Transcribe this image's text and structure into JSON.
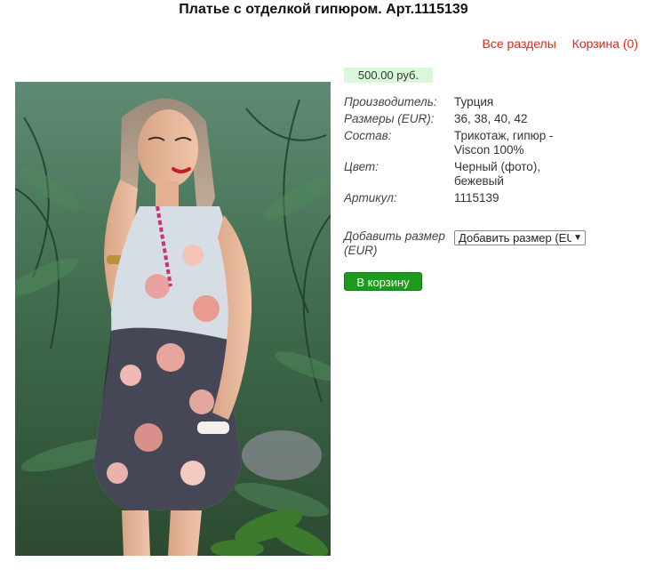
{
  "product": {
    "title": "Платье с отделкой гипюром. Арт.1115139",
    "price": "500.00 руб.",
    "props": [
      {
        "k": "Производитель:",
        "v": "Турция"
      },
      {
        "k": "Размеры (EUR):",
        "v": "36, 38, 40, 42"
      },
      {
        "k": "Состав:",
        "v": "Трикотаж, гипюр - Viscon 100%"
      },
      {
        "k": "Цвет:",
        "v": "Черный (фото), бежевый"
      },
      {
        "k": "Артикул:",
        "v": "1115139"
      }
    ],
    "add_size_label": "Добавить размер (EUR)",
    "size_select_value": "Добавить размер (EU",
    "cart_button": "В корзину"
  },
  "links": {
    "all_sections": "Все разделы",
    "cart": "Корзина (0)"
  },
  "colors": {
    "link": "#e0261b",
    "price_bg": "#d9f7d9",
    "cart_bg": "#1e9b1e"
  }
}
